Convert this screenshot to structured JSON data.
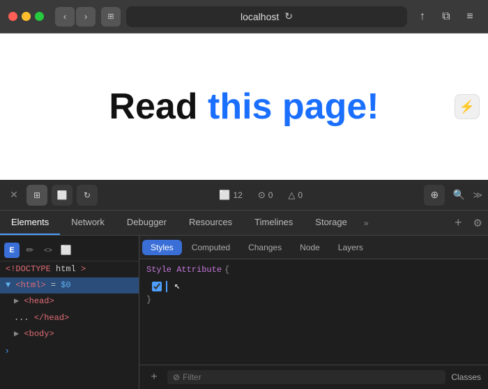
{
  "browser": {
    "address": "localhost",
    "traffic_lights": [
      "red",
      "yellow",
      "green"
    ],
    "back_label": "‹",
    "forward_label": "›",
    "sidebar_icon": "⊞",
    "reload_icon": "↻",
    "share_icon": "↑",
    "tabs_icon": "⧉"
  },
  "page": {
    "heading_black": "Read ",
    "heading_blue": "this page!"
  },
  "reader_button": {
    "icon": "⚡"
  },
  "devtools_toolbar": {
    "close_label": "✕",
    "layout_icon": "⊞",
    "sidepanel_icon": "⬜",
    "reload_icon": "↻",
    "console_badge": "12",
    "error_badge": "0",
    "warning_badge": "0",
    "crosshair_icon": "⊕",
    "search_icon": "🔍",
    "more_label": "≫"
  },
  "devtools_tabs": [
    {
      "label": "Elements",
      "active": true
    },
    {
      "label": "Network",
      "active": false
    },
    {
      "label": "Debugger",
      "active": false
    },
    {
      "label": "Resources",
      "active": false
    },
    {
      "label": "Timelines",
      "active": false
    },
    {
      "label": "Storage",
      "active": false
    }
  ],
  "dom_toolbar": [
    {
      "icon": "E",
      "label": "element-picker",
      "active": true
    },
    {
      "icon": "✏",
      "label": "edit-icon"
    },
    {
      "icon": "<>",
      "label": "html-icon"
    },
    {
      "icon": "⬜",
      "label": "layout-icon"
    }
  ],
  "dom_nodes": [
    {
      "text": "<!DOCTYPE html>",
      "type": "doctype"
    },
    {
      "text": "<html> = $0",
      "type": "selected"
    },
    {
      "text": "▶ <head>",
      "type": "collapsed"
    },
    {
      "text": "...</head>",
      "type": "normal"
    },
    {
      "text": "▶ <body>",
      "type": "collapsed"
    }
  ],
  "styles_subtabs": [
    {
      "label": "Styles",
      "active": true
    },
    {
      "label": "Computed",
      "active": false
    },
    {
      "label": "Changes",
      "active": false
    },
    {
      "label": "Node",
      "active": false
    },
    {
      "label": "Layers",
      "active": false
    }
  ],
  "styles_rule": {
    "selector": "Style Attribute",
    "open_brace": "{",
    "close_brace": "}"
  },
  "styles_footer": {
    "add_icon": "+",
    "filter_icon": "⊘",
    "filter_placeholder": "Filter",
    "classes_label": "Classes"
  }
}
